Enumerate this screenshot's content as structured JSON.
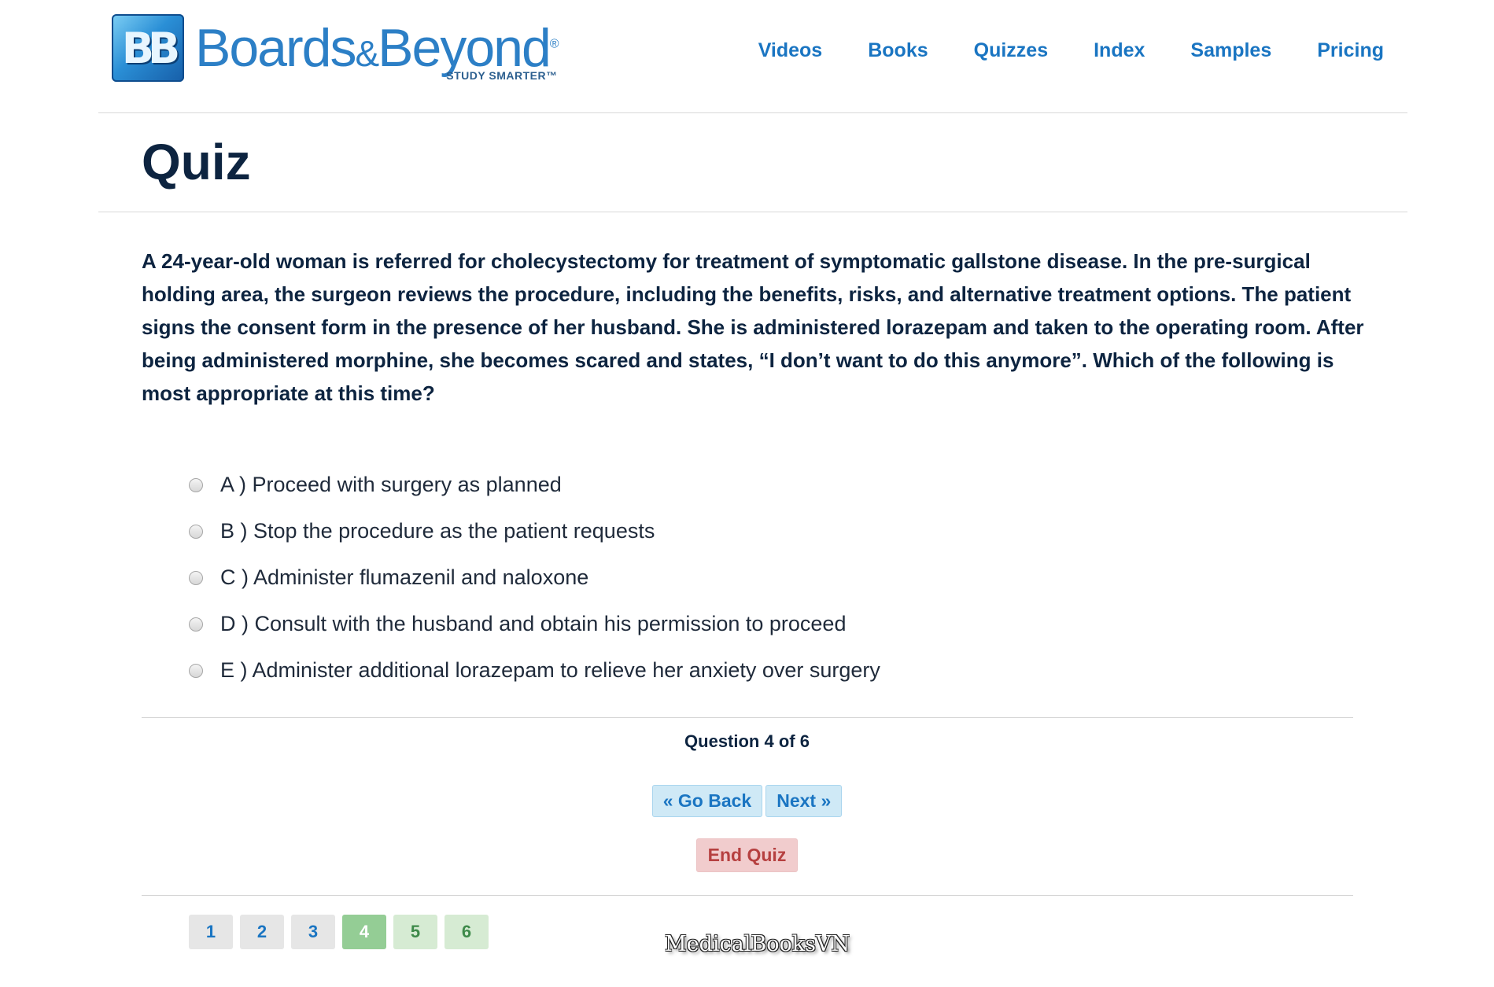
{
  "header": {
    "logo": {
      "mark": "BB",
      "name_part1": "Boards",
      "amp": "&",
      "name_part2": "Beyond",
      "reg": "®",
      "tagline": "STUDY SMARTER™"
    },
    "nav": [
      "Videos",
      "Books",
      "Quizzes",
      "Index",
      "Samples",
      "Pricing"
    ]
  },
  "page_title": "Quiz",
  "question": "A 24-year-old woman is referred for cholecystectomy for treatment of symptomatic gallstone disease. In the pre-surgical holding area, the surgeon reviews the procedure, including the benefits, risks, and alternative treatment options. The patient signs the consent form in the presence of her husband. She is administered lorazepam and taken to the operating room. After being administered morphine, she becomes scared and states, “I don’t want to do this anymore”. Which of the following is most appropriate at this time?",
  "options": [
    "A ) Proceed with surgery as planned",
    "B ) Stop the procedure as the patient requests",
    "C ) Administer flumazenil and naloxone",
    "D ) Consult with the husband and obtain his permission to proceed",
    "E ) Administer additional lorazepam to relieve her anxiety over surgery"
  ],
  "selected_option": null,
  "progress": {
    "counter_text": "Question 4 of 6",
    "current": 4,
    "total": 6
  },
  "buttons": {
    "go_back": "« Go Back",
    "next": "Next »",
    "end_quiz": "End Quiz"
  },
  "pager": [
    "1",
    "2",
    "3",
    "4",
    "5",
    "6"
  ],
  "watermark": "MedicalBooksVN",
  "colors": {
    "brand_blue": "#1a75c2",
    "title_navy": "#0d2440",
    "end_quiz_red": "#b64040",
    "current_page_green": "#94cd95"
  }
}
